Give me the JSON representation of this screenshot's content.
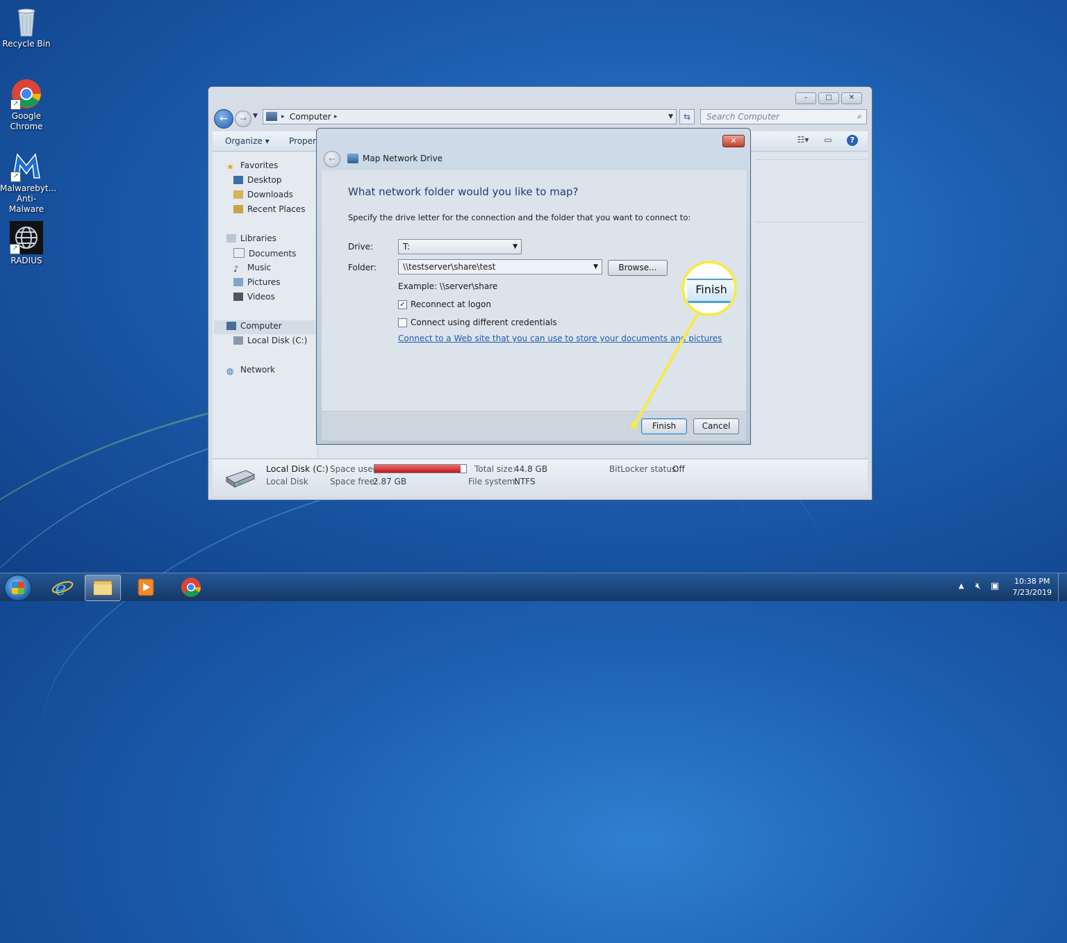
{
  "desktop": {
    "icons": [
      {
        "label": "Recycle Bin"
      },
      {
        "label": "Google Chrome"
      },
      {
        "label": "Malwarebyt... Anti-Malware"
      },
      {
        "label": "RADIUS"
      }
    ]
  },
  "explorer": {
    "address": {
      "crumb": "Computer"
    },
    "search_placeholder": "Search Computer",
    "toolbar": {
      "organize": "Organize",
      "properties": "Propert"
    },
    "nav": {
      "favorites": "Favorites",
      "desktop": "Desktop",
      "downloads": "Downloads",
      "recent_places": "Recent Places",
      "libraries": "Libraries",
      "documents": "Documents",
      "music": "Music",
      "pictures": "Pictures",
      "videos": "Videos",
      "computer": "Computer",
      "local_disk": "Local Disk (C:)",
      "network": "Network"
    },
    "details": {
      "name": "Local Disk (C:)",
      "type": "Local Disk",
      "space_used_label": "Space used:",
      "space_free_label": "Space free:",
      "space_free": "2.87 GB",
      "total_size_label": "Total size:",
      "total_size": "44.8 GB",
      "file_system_label": "File system:",
      "file_system": "NTFS",
      "bitlocker_label": "BitLocker status:",
      "bitlocker": "Off",
      "used_fraction": 0.94
    }
  },
  "dialog": {
    "title": "Map Network Drive",
    "heading": "What network folder would you like to map?",
    "instruction": "Specify the drive letter for the connection and the folder that you want to connect to:",
    "drive_label": "Drive:",
    "drive_value": "T:",
    "folder_label": "Folder:",
    "folder_value": "\\\\testserver\\share\\test",
    "browse": "Browse...",
    "example": "Example: \\\\server\\share",
    "reconnect": "Reconnect at logon",
    "reconnect_checked": true,
    "credentials": "Connect using different credentials",
    "credentials_checked": false,
    "link": "Connect to a Web site that you can use to store your documents and pictures",
    "finish": "Finish",
    "cancel": "Cancel"
  },
  "callout": {
    "label": "Finish",
    "color": "#f7ea4a"
  },
  "taskbar": {
    "clock_time": "10:38 PM",
    "clock_date": "7/23/2019"
  }
}
